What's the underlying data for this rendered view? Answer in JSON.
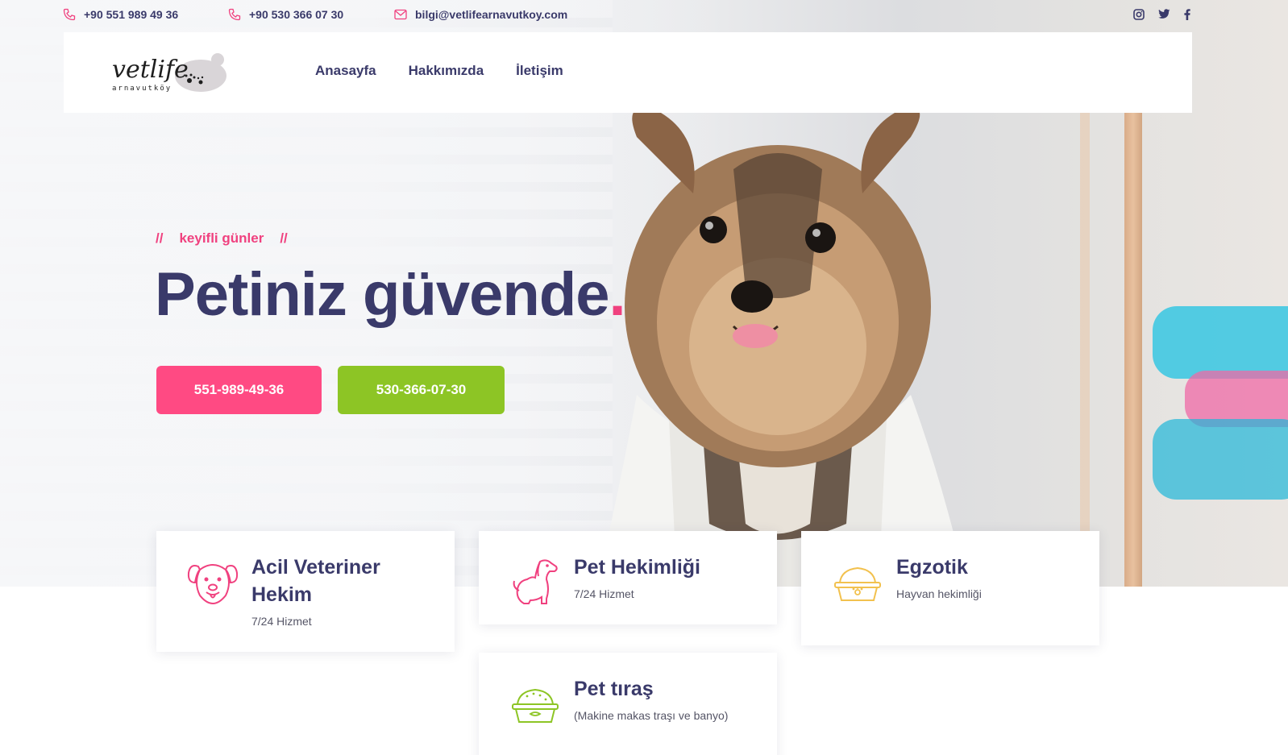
{
  "topbar": {
    "phone1": "+90 551 989 49 36",
    "phone2": "+90 530 366 07 30",
    "email": "bilgi@vetlifearnavutkoy.com",
    "social": [
      "instagram-icon",
      "twitter-icon",
      "facebook-icon"
    ]
  },
  "logo": {
    "text": "vetlife",
    "subtext": "arnavutköy"
  },
  "nav": {
    "items": [
      "Anasayfa",
      "Hakkımızda",
      "İletişim"
    ]
  },
  "hero": {
    "tagline_prefix": "//",
    "tagline": "keyifli günler",
    "tagline_suffix": "//",
    "headline": "Petiniz güvende",
    "headline_dot": ".",
    "button1": "551-989-49-36",
    "button2": "530-366-07-30"
  },
  "services": [
    {
      "title": "Acil Veteriner Hekim",
      "sub": "7/24 Hizmet",
      "icon": "dog-face-icon"
    },
    {
      "title": "Pet Hekimliği",
      "sub": "7/24 Hizmet",
      "icon": "dog-sitting-icon"
    },
    {
      "title": "Egzotik",
      "sub": "Hayvan hekimliği",
      "icon": "pet-food-bowl-icon"
    },
    {
      "title": "Pet tıraş",
      "sub": "(Makine makas traşı ve banyo)",
      "icon": "pet-food-bowl-icon"
    }
  ],
  "colors": {
    "navy": "#3a3a6a",
    "pink": "#ff4a83",
    "green": "#8dc525",
    "yellow": "#f2c14e"
  }
}
